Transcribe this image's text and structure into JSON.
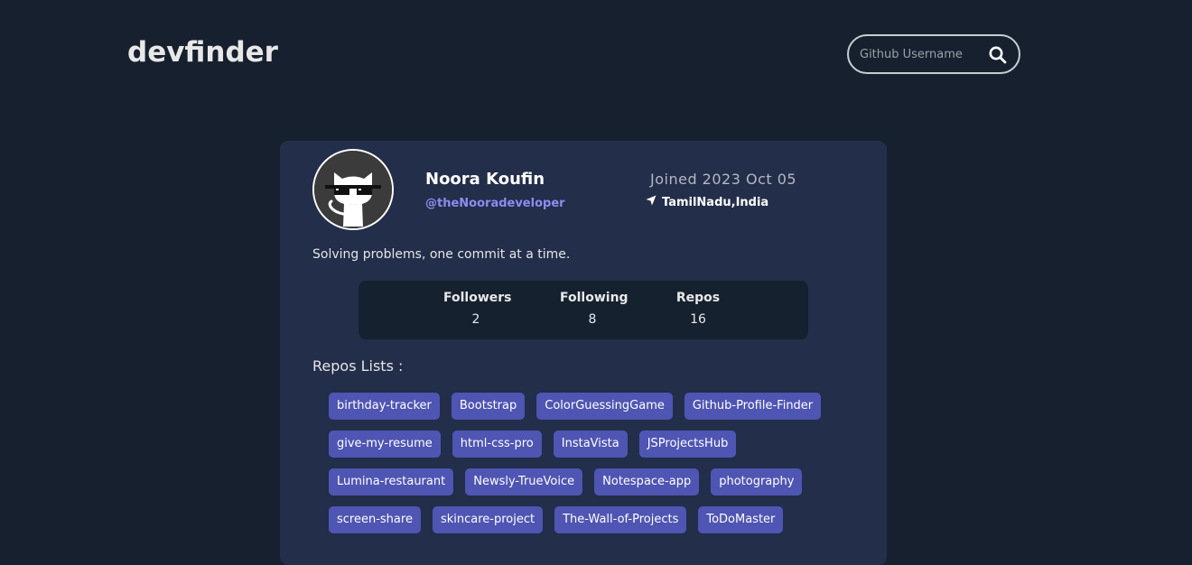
{
  "header": {
    "logo": "devfinder",
    "search_placeholder": "Github Username",
    "search_value": ""
  },
  "profile": {
    "name": "Noora Koufin",
    "login": "@theNooradeveloper",
    "joined": "Joined 2023 Oct 05",
    "location": "TamilNadu,India",
    "bio": "Solving problems, one commit at a time."
  },
  "stats": [
    {
      "label": "Followers",
      "value": "2"
    },
    {
      "label": "Following",
      "value": "8"
    },
    {
      "label": "Repos",
      "value": "16"
    }
  ],
  "repos_title": "Repos Lists :",
  "repos": [
    "birthday-tracker",
    "Bootstrap",
    "ColorGuessingGame",
    "Github-Profile-Finder",
    "give-my-resume",
    "html-css-pro",
    "InstaVista",
    "JSProjectsHub",
    "Lumina-restaurant",
    "Newsly-TrueVoice",
    "Notespace-app",
    "photography",
    "screen-share",
    "skincare-project",
    "The-Wall-of-Projects",
    "ToDoMaster"
  ],
  "icons": {
    "search": "search-icon",
    "location": "location-arrow-icon",
    "avatar": "github-octocat-sunglasses-avatar"
  },
  "colors": {
    "background": "#17202e",
    "card": "#222e4a",
    "stats_panel": "#16212f",
    "accent": "#4f55b3",
    "login_link": "#8c8cf0"
  }
}
